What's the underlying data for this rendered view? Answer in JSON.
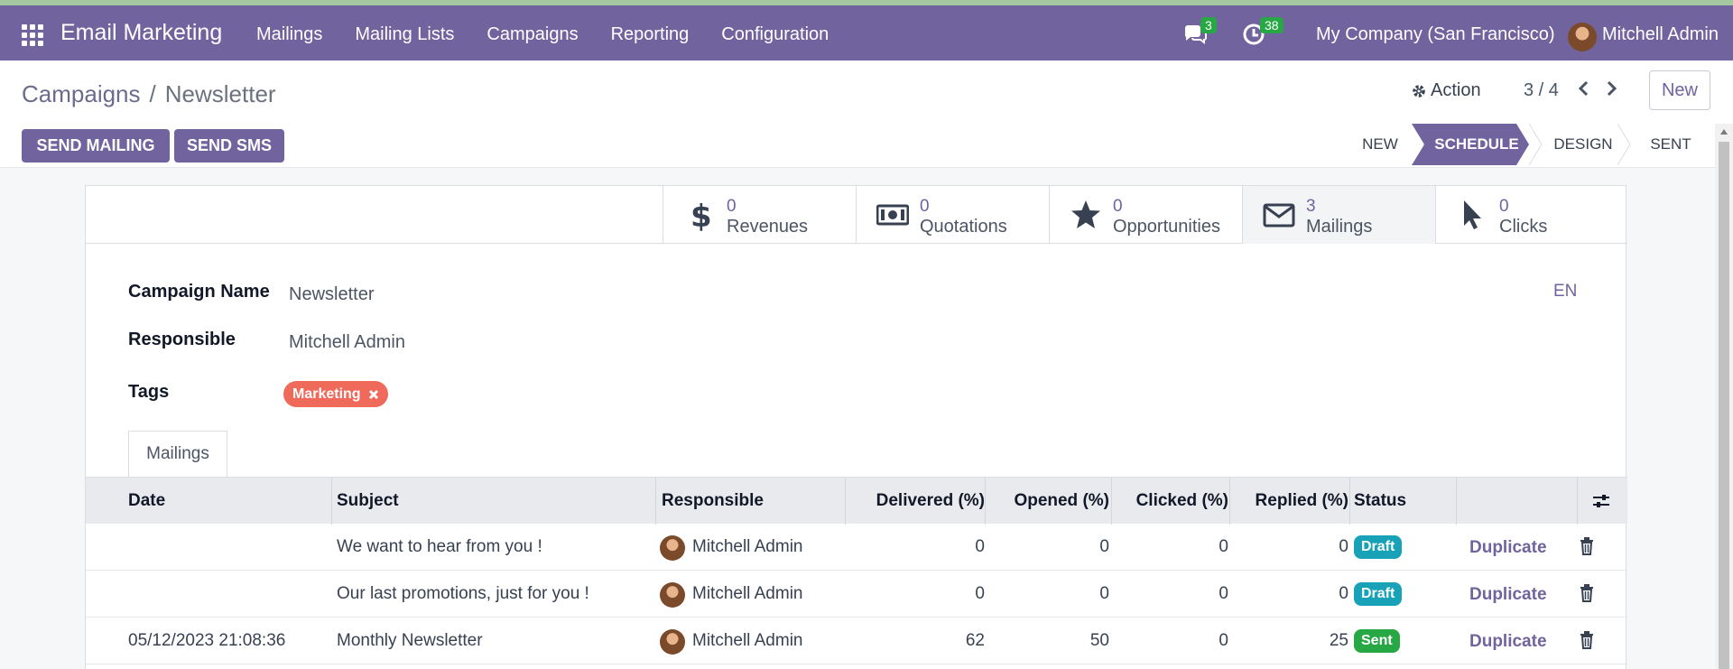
{
  "navbar": {
    "app_title": "Email Marketing",
    "menu": [
      "Mailings",
      "Mailing Lists",
      "Campaigns",
      "Reporting",
      "Configuration"
    ],
    "messages_count": "3",
    "activities_count": "38",
    "company": "My Company (San Francisco)",
    "user": "Mitchell Admin"
  },
  "control": {
    "breadcrumb_parent": "Campaigns",
    "breadcrumb_sep": "/",
    "breadcrumb_current": "Newsletter",
    "action_label": "Action",
    "pager": "3 / 4",
    "new_label": "New"
  },
  "buttons": {
    "send_mailing": "SEND MAILING",
    "send_sms": "SEND SMS"
  },
  "status_steps": [
    "NEW",
    "SCHEDULE",
    "DESIGN",
    "SENT"
  ],
  "active_status": "SCHEDULE",
  "stats": [
    {
      "value": "0",
      "label": "Revenues",
      "icon": "dollar-icon"
    },
    {
      "value": "0",
      "label": "Quotations",
      "icon": "money-bill-icon"
    },
    {
      "value": "0",
      "label": "Opportunities",
      "icon": "star-icon"
    },
    {
      "value": "3",
      "label": "Mailings",
      "icon": "envelope-icon"
    },
    {
      "value": "0",
      "label": "Clicks",
      "icon": "cursor-icon"
    }
  ],
  "form": {
    "campaign_name_label": "Campaign Name",
    "campaign_name": "Newsletter",
    "responsible_label": "Responsible",
    "responsible": "Mitchell Admin",
    "tags_label": "Tags",
    "tag": "Marketing",
    "lang": "EN"
  },
  "tab_label": "Mailings",
  "table": {
    "headers": [
      "Date",
      "Subject",
      "Responsible",
      "Delivered (%)",
      "Opened (%)",
      "Clicked (%)",
      "Replied (%)",
      "Status"
    ],
    "rows": [
      {
        "date": "",
        "subject": "We want to hear from you !",
        "responsible": "Mitchell Admin",
        "delivered": "0",
        "opened": "0",
        "clicked": "0",
        "replied": "0",
        "status": "Draft",
        "action": "Duplicate"
      },
      {
        "date": "",
        "subject": "Our last promotions, just for you !",
        "responsible": "Mitchell Admin",
        "delivered": "0",
        "opened": "0",
        "clicked": "0",
        "replied": "0",
        "status": "Draft",
        "action": "Duplicate"
      },
      {
        "date": "05/12/2023 21:08:36",
        "subject": "Monthly Newsletter",
        "responsible": "Mitchell Admin",
        "delivered": "62",
        "opened": "50",
        "clicked": "0",
        "replied": "25",
        "status": "Sent",
        "action": "Duplicate"
      }
    ]
  },
  "colors": {
    "brand": "#71639e",
    "draft_badge": "#17a2b8",
    "sent_badge": "#28a745",
    "tag": "#f06a5b"
  }
}
